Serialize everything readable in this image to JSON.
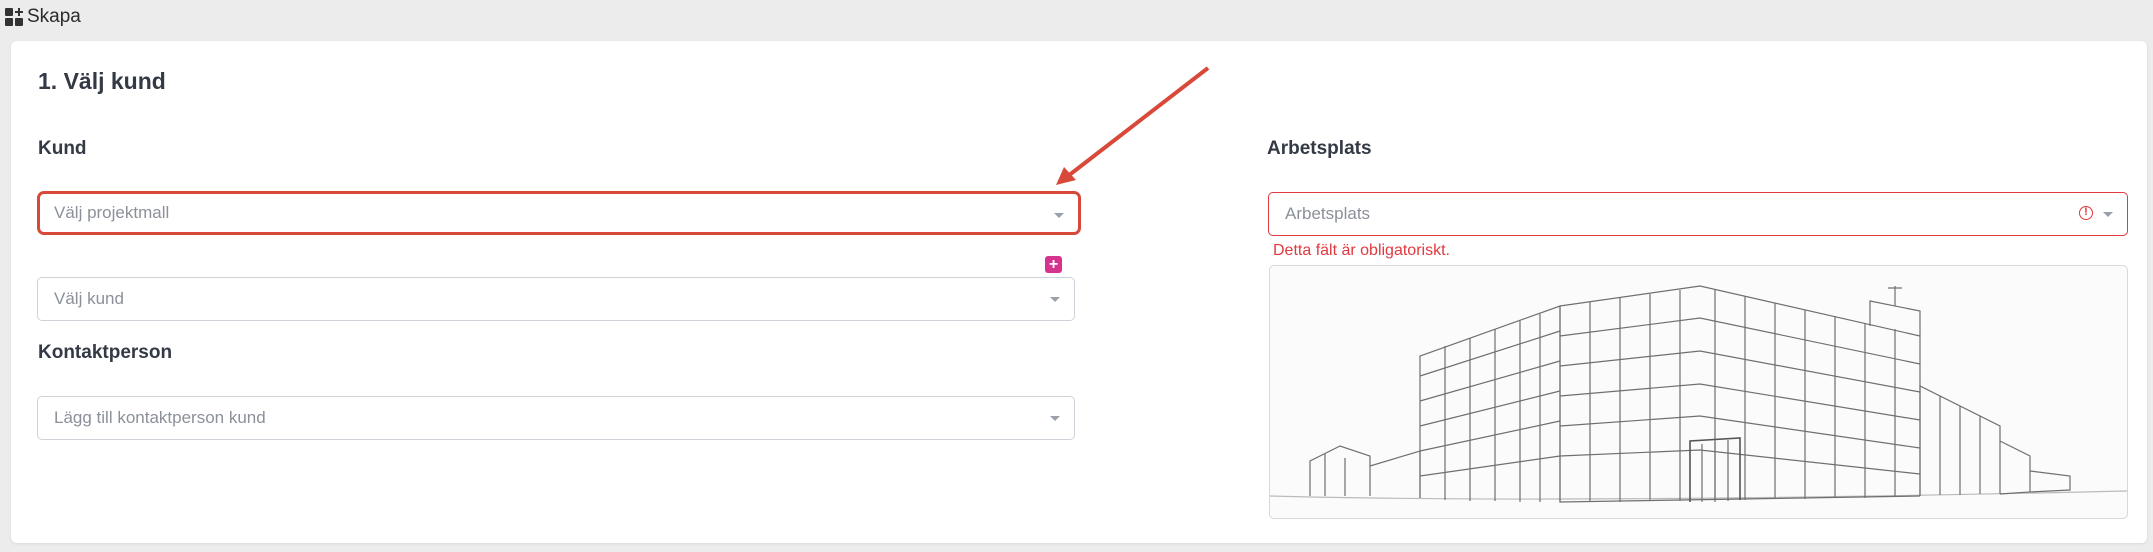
{
  "header": {
    "title": "Skapa",
    "icon": "apps-grid-icon"
  },
  "form": {
    "step_title": "1. Välj kund",
    "kund": {
      "label": "Kund",
      "template_select": {
        "placeholder": "Välj projektmall"
      },
      "customer_select": {
        "placeholder": "Välj kund"
      },
      "add_button": "+"
    },
    "kontaktperson": {
      "label": "Kontaktperson",
      "select": {
        "placeholder": "Lägg till kontaktperson kund"
      }
    },
    "arbetsplats": {
      "label": "Arbetsplats",
      "select": {
        "placeholder": "Arbetsplats"
      },
      "error": "Detta fält är obligatoriskt.",
      "image": "building-sketch"
    }
  },
  "colors": {
    "annotation": "#d9493a",
    "error": "#e0393e",
    "add": "#d6338f"
  }
}
